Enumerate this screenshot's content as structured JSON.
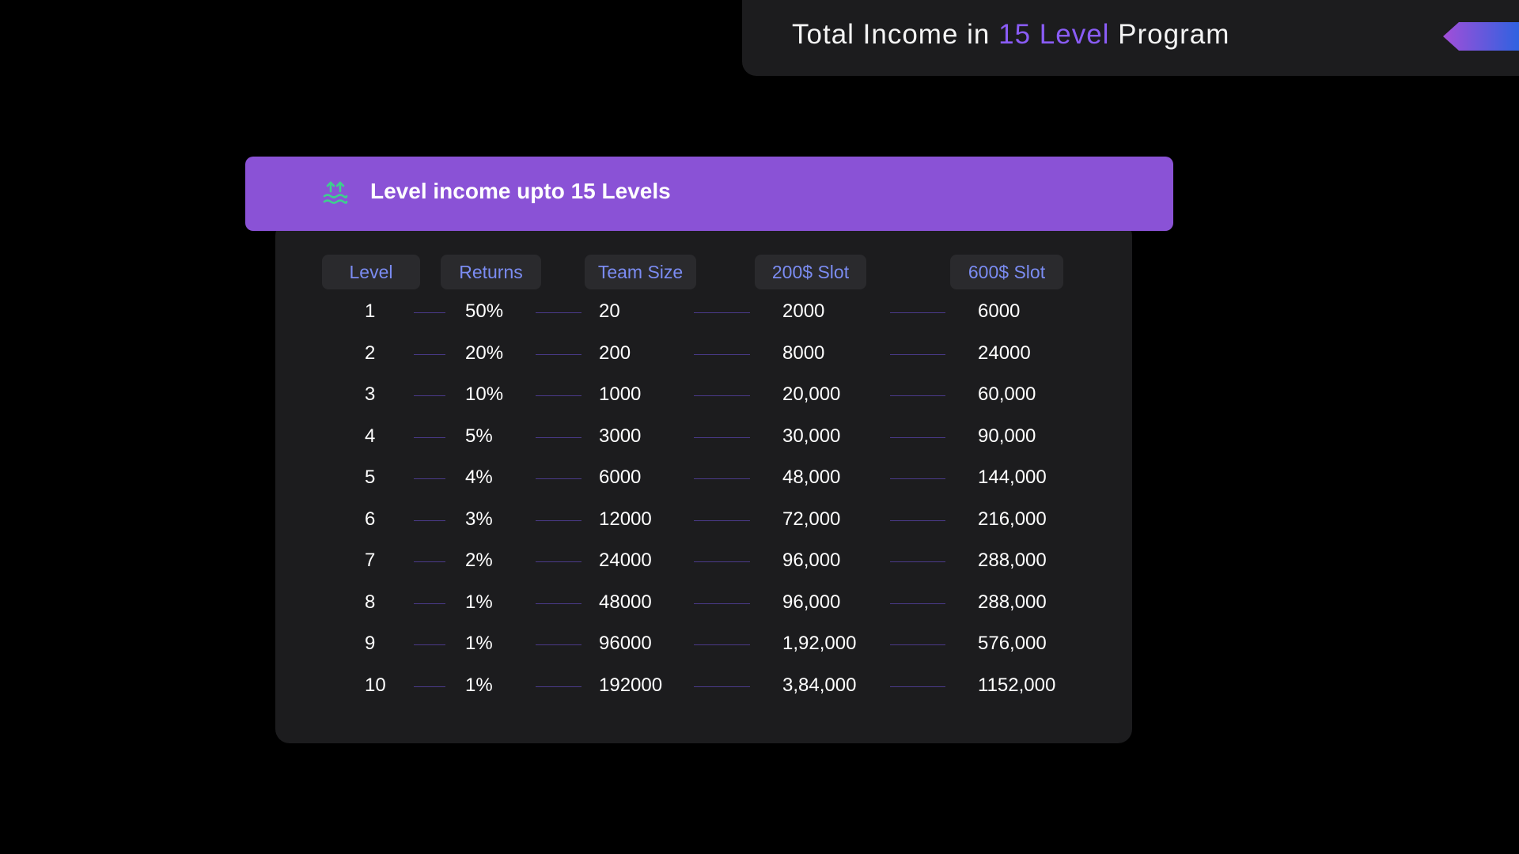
{
  "title": {
    "prefix": "Total Income in ",
    "accent": "15 Level",
    "suffix": " Program"
  },
  "banner": {
    "icon": "level-up-arrows-icon",
    "text": "Level income upto 15 Levels"
  },
  "colors": {
    "accent": "#8a5cf6",
    "band": "#8a52d6",
    "header_text": "#7b8cf2",
    "icon": "#3ecf8e"
  },
  "table": {
    "headers": [
      "Level",
      "Returns",
      "Team Size",
      "200$ Slot",
      "600$ Slot"
    ],
    "rows": [
      [
        "1",
        "50%",
        "20",
        "2000",
        "6000"
      ],
      [
        "2",
        "20%",
        "200",
        "8000",
        "24000"
      ],
      [
        "3",
        "10%",
        "1000",
        "20,000",
        "60,000"
      ],
      [
        "4",
        "5%",
        "3000",
        "30,000",
        "90,000"
      ],
      [
        "5",
        "4%",
        "6000",
        "48,000",
        "144,000"
      ],
      [
        "6",
        "3%",
        "12000",
        "72,000",
        "216,000"
      ],
      [
        "7",
        "2%",
        "24000",
        "96,000",
        "288,000"
      ],
      [
        "8",
        "1%",
        "48000",
        "96,000",
        "288,000"
      ],
      [
        "9",
        "1%",
        "96000",
        "1,92,000",
        "576,000"
      ],
      [
        "10",
        "1%",
        "192000",
        "3,84,000",
        "1152,000"
      ]
    ]
  }
}
